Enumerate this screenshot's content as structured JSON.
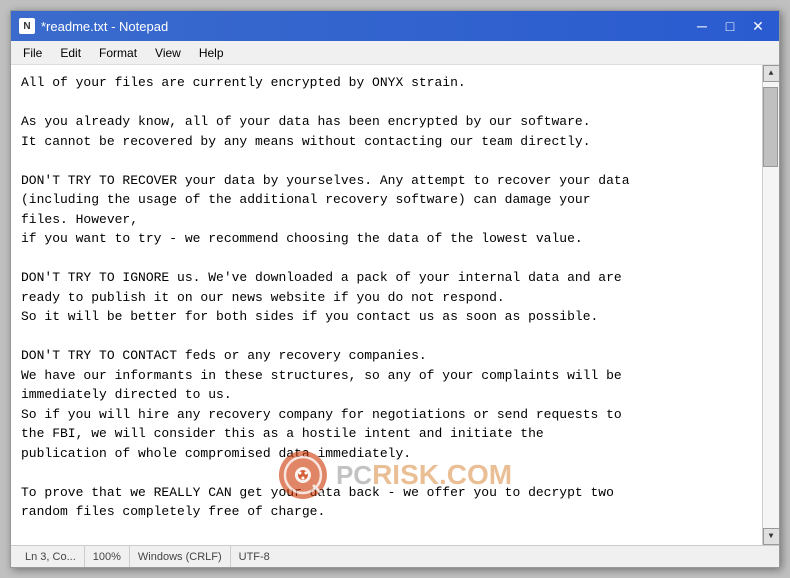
{
  "window": {
    "title": "*readme.txt - Notepad",
    "icon_label": "N"
  },
  "controls": {
    "minimize": "─",
    "maximize": "□",
    "close": "✕"
  },
  "menu": {
    "items": [
      "File",
      "Edit",
      "Format",
      "View",
      "Help"
    ]
  },
  "content": {
    "text": "All of your files are currently encrypted by ONYX strain.\n\nAs you already know, all of your data has been encrypted by our software.\nIt cannot be recovered by any means without contacting our team directly.\n\nDON'T TRY TO RECOVER your data by yourselves. Any attempt to recover your data\n(including the usage of the additional recovery software) can damage your\nfiles. However,\nif you want to try - we recommend choosing the data of the lowest value.\n\nDON'T TRY TO IGNORE us. We've downloaded a pack of your internal data and are\nready to publish it on our news website if you do not respond.\nSo it will be better for both sides if you contact us as soon as possible.\n\nDON'T TRY TO CONTACT feds or any recovery companies.\nWe have our informants in these structures, so any of your complaints will be\nimmediately directed to us.\nSo if you will hire any recovery company for negotiations or send requests to\nthe FBI, we will consider this as a hostile intent and initiate the\npublication of whole compromised data immediately.\n\nTo prove that we REALLY CAN get your data back - we offer you to decrypt two\nrandom files completely free of charge."
  },
  "status_bar": {
    "position": "Ln 3, Co...",
    "zoom": "100%",
    "line_ending": "Windows (CRLF)",
    "encoding": "UTF-8"
  },
  "watermark": {
    "text": "RISK.COM"
  }
}
